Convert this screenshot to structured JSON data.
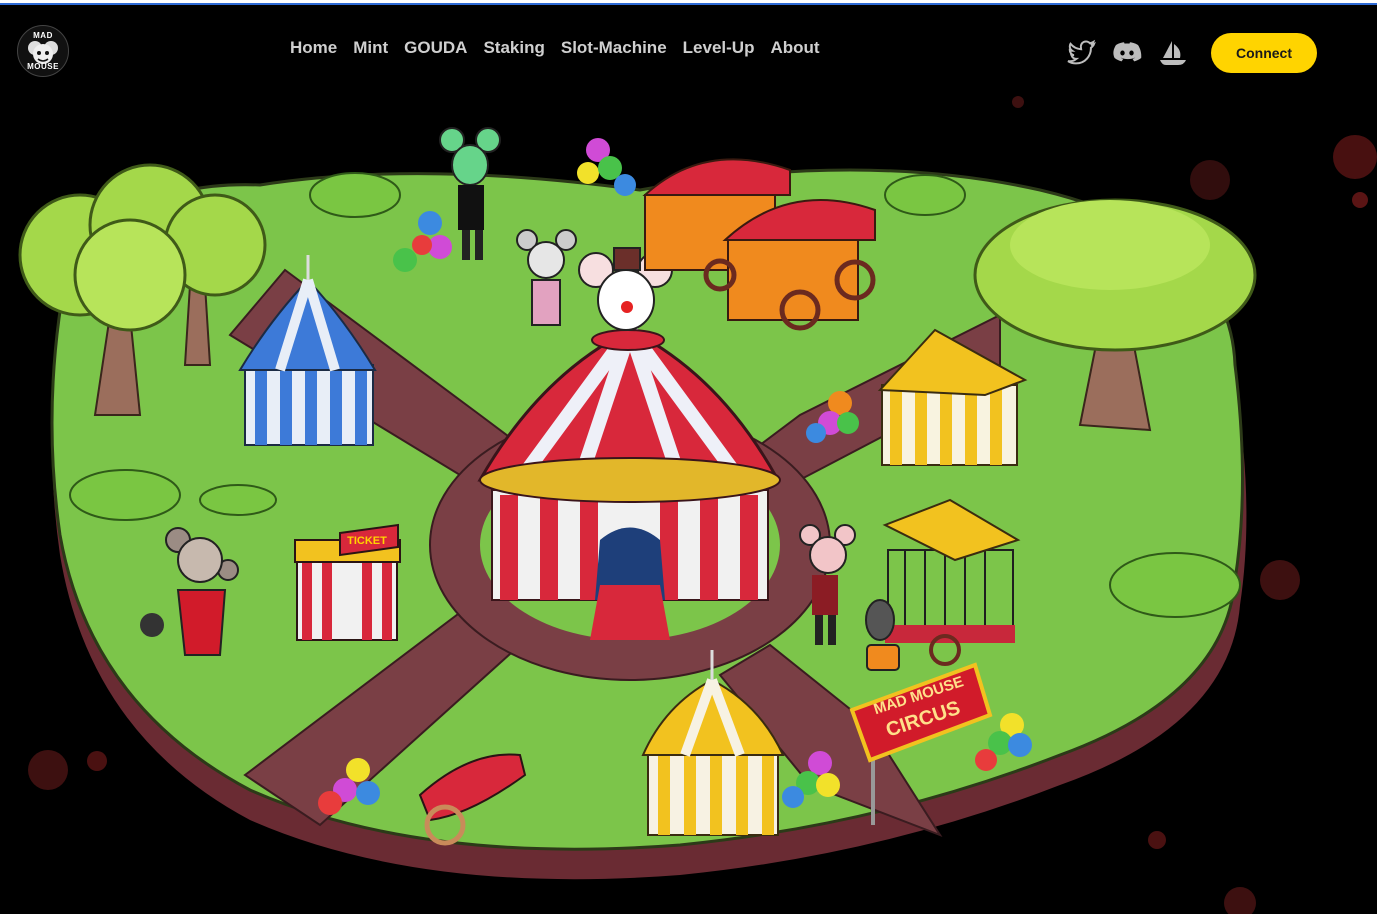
{
  "brand": {
    "logo_line1": "MAD",
    "logo_line2": "MOUSE"
  },
  "nav": {
    "items": [
      {
        "label": "Home"
      },
      {
        "label": "Mint"
      },
      {
        "label": "GOUDA"
      },
      {
        "label": "Staking"
      },
      {
        "label": "Slot-Machine"
      },
      {
        "label": "Level-Up"
      },
      {
        "label": "About"
      }
    ],
    "social": [
      "twitter-icon",
      "discord-icon",
      "opensea-icon"
    ],
    "connect_label": "Connect"
  },
  "scene": {
    "ticket_sign": "TICKET",
    "circus_sign_line1": "MAD MOUSE",
    "circus_sign_line2": "CIRCUS"
  },
  "colors": {
    "accent": "#ffd400",
    "grass": "#7cc54a",
    "path": "#7a3f45",
    "island_edge": "#6a2b33",
    "tent_red": "#d8283b",
    "tent_blue": "#3d7ad8",
    "tent_yellow": "#f2c21f"
  }
}
